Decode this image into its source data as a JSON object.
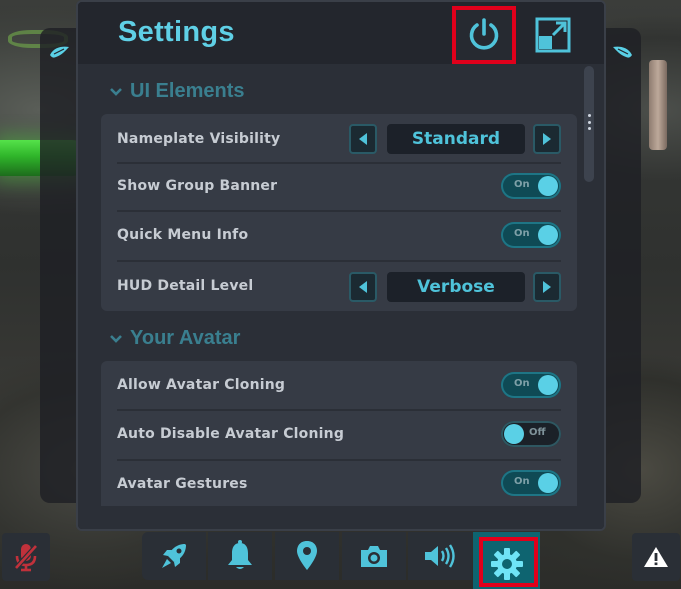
{
  "window": {
    "title": "Settings"
  },
  "colors": {
    "accent": "#5fd0e6",
    "section_header": "#3a7f8f",
    "panel_bg": "#2b2f37",
    "card_bg": "#363b45",
    "toggle_on": "#5ad0e6",
    "highlight_frame": "#e0001b",
    "active_tool": "#0e6470"
  },
  "header": {
    "power_icon": "power-icon",
    "expand_icon": "expand-icon"
  },
  "sections": [
    {
      "title": "UI Elements",
      "rows": [
        {
          "label": "Nameplate Visibility",
          "type": "selector",
          "value": "Standard"
        },
        {
          "label": "Show Group Banner",
          "type": "toggle",
          "state": "On"
        },
        {
          "label": "Quick Menu Info",
          "type": "toggle",
          "state": "On"
        },
        {
          "label": "HUD Detail Level",
          "type": "selector",
          "value": "Verbose"
        }
      ]
    },
    {
      "title": "Your Avatar",
      "rows": [
        {
          "label": "Allow Avatar Cloning",
          "type": "toggle",
          "state": "On"
        },
        {
          "label": "Auto Disable Avatar Cloning",
          "type": "toggle",
          "state": "Off"
        },
        {
          "label": "Avatar Gestures",
          "type": "toggle",
          "state": "On"
        }
      ]
    }
  ],
  "toolbar": {
    "items": [
      {
        "icon": "rocket-icon"
      },
      {
        "icon": "bell-icon"
      },
      {
        "icon": "location-pin-icon"
      },
      {
        "icon": "camera-icon"
      },
      {
        "icon": "speaker-icon"
      },
      {
        "icon": "gear-icon",
        "active": true
      }
    ],
    "mic_icon": "mic-muted-icon",
    "alert_icon": "warning-icon"
  }
}
